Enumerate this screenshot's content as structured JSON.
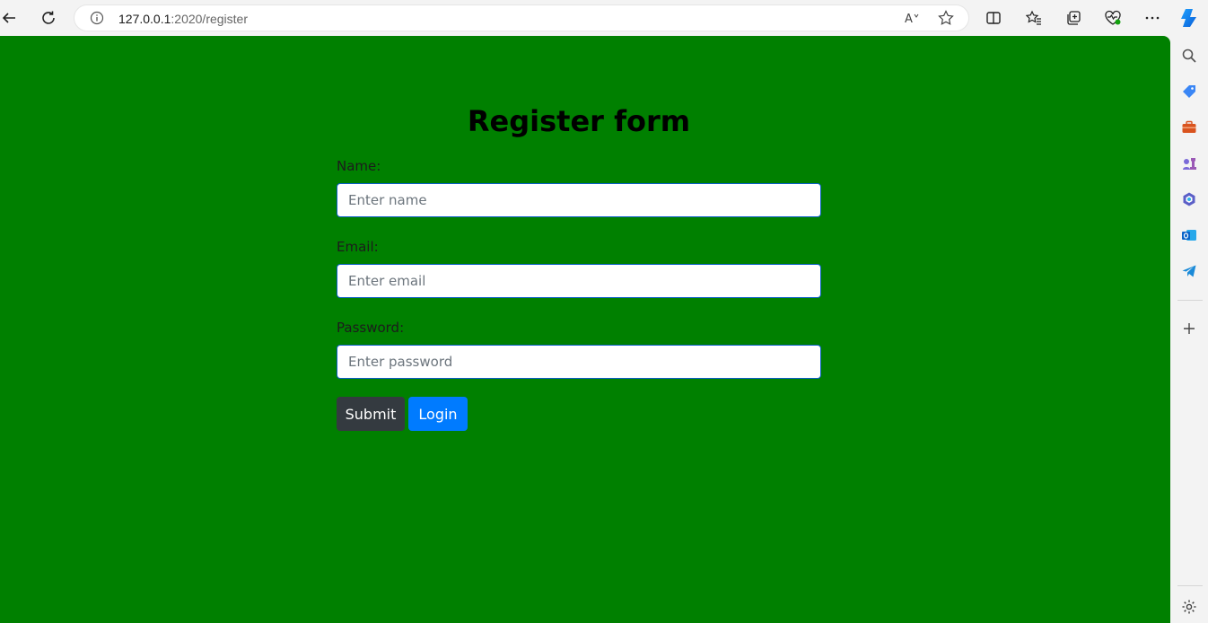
{
  "browser": {
    "url_host": "127.0.0.1",
    "url_path": ":2020/register"
  },
  "page": {
    "background": "#008000",
    "title": "Register form",
    "fields": [
      {
        "label": "Name:",
        "placeholder": "Enter name",
        "value": ""
      },
      {
        "label": "Email:",
        "placeholder": "Enter email",
        "value": ""
      },
      {
        "label": "Password:",
        "placeholder": "Enter password",
        "value": ""
      }
    ],
    "buttons": {
      "submit": "Submit",
      "login": "Login"
    }
  },
  "colors": {
    "submit_bg": "#343a40",
    "login_bg": "#007bff"
  },
  "sidebar_icons": [
    "search-icon",
    "shopping-tag-icon",
    "tools-icon",
    "games-icon",
    "m365-icon",
    "outlook-icon",
    "telegram-icon",
    "add-icon",
    "settings-icon"
  ]
}
